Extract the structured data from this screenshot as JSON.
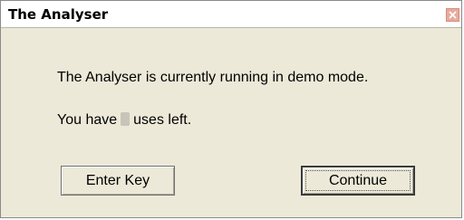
{
  "window": {
    "title": "The Analyser",
    "close_icon": "close-icon"
  },
  "body": {
    "message": "The Analyser is currently running in demo mode.",
    "uses_prefix": "You have",
    "uses_suffix": "uses left.",
    "uses_count_obscured": true
  },
  "buttons": {
    "enter_key_label": "Enter Key",
    "continue_label": "Continue"
  },
  "colors": {
    "dialog_bg": "#ece9d8",
    "close_button_bg": "#e8aa9c"
  }
}
